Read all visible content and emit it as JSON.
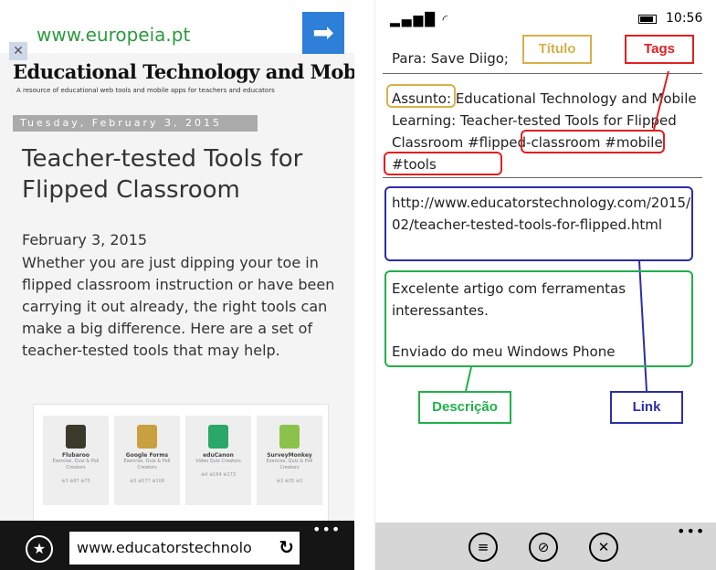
{
  "left_phone": {
    "ad": {
      "url": "www.europeia.pt",
      "arrow": "➡",
      "close": "✕"
    },
    "blog": {
      "title": "Educational Technology and Mobile Learning",
      "subtitle": "A resource of educational web tools and          mobile apps for teachers and educators"
    },
    "date_bar": "Tuesday, February 3, 2015",
    "post": {
      "title": "Teacher-tested Tools for Flipped Classroom",
      "date": "February 3, 2015",
      "body": "Whether you are just dipping your toe in flipped classroom instruction or have been carrying it out already, the right tools can make a big difference. Here are a set of teacher-tested tools that may help."
    },
    "tools": [
      {
        "name": "Flubaroo",
        "category": "Exercise, Quiz & Poll Creators",
        "stats": "⊕3 ⊕87 ⊕75",
        "color": "#3a3a2a"
      },
      {
        "name": "Google Forms",
        "category": "Exercise, Quiz & Poll Creators",
        "stats": "⊕3 ⊕577 ⊕108",
        "color": "#c8a040"
      },
      {
        "name": "eduCanon",
        "category": "Video Quiz Creators",
        "stats": "⊕4 ⊕164 ⊕173",
        "color": "#2aa86a"
      },
      {
        "name": "SurveyMonkey",
        "category": "Exercise, Quiz & Poll Creators",
        "stats": "⊕3 ⊕35 ⊕3",
        "color": "#8bc34a"
      }
    ],
    "browser": {
      "address": "www.educatorstechnolo",
      "more": "•••",
      "fav": "★",
      "refresh": "↻"
    }
  },
  "right_phone": {
    "status": {
      "signal": "▂▄▆█",
      "wifi": "◜",
      "time": "10:56"
    },
    "to_label": "Para:",
    "to_value": "Save Diigo;",
    "subject_label": "Assunto:",
    "subject_text": "Educational Technology and Mobile Learning: Teacher-tested Tools for Flipped Classroom",
    "tags": "#flipped-classroom #mobile #tools",
    "link": "http://www.educatorstechnology.com/2015/02/teacher-tested-tools-for-flipped.html",
    "body": "Excelente artigo com ferramentas interessantes.",
    "signature": "Enviado do meu Windows Phone",
    "appbar": {
      "send": "≡",
      "attach": "⊘",
      "cancel": "✕",
      "more": "•••"
    }
  },
  "annotations": {
    "titulo": {
      "label": "Título",
      "color": "#d7b04a"
    },
    "tags": {
      "label": "Tags",
      "color": "#e02020"
    },
    "descricao": {
      "label": "Descrição",
      "color": "#21b04a"
    },
    "link": {
      "label": "Link",
      "color": "#2a2fa8"
    }
  }
}
